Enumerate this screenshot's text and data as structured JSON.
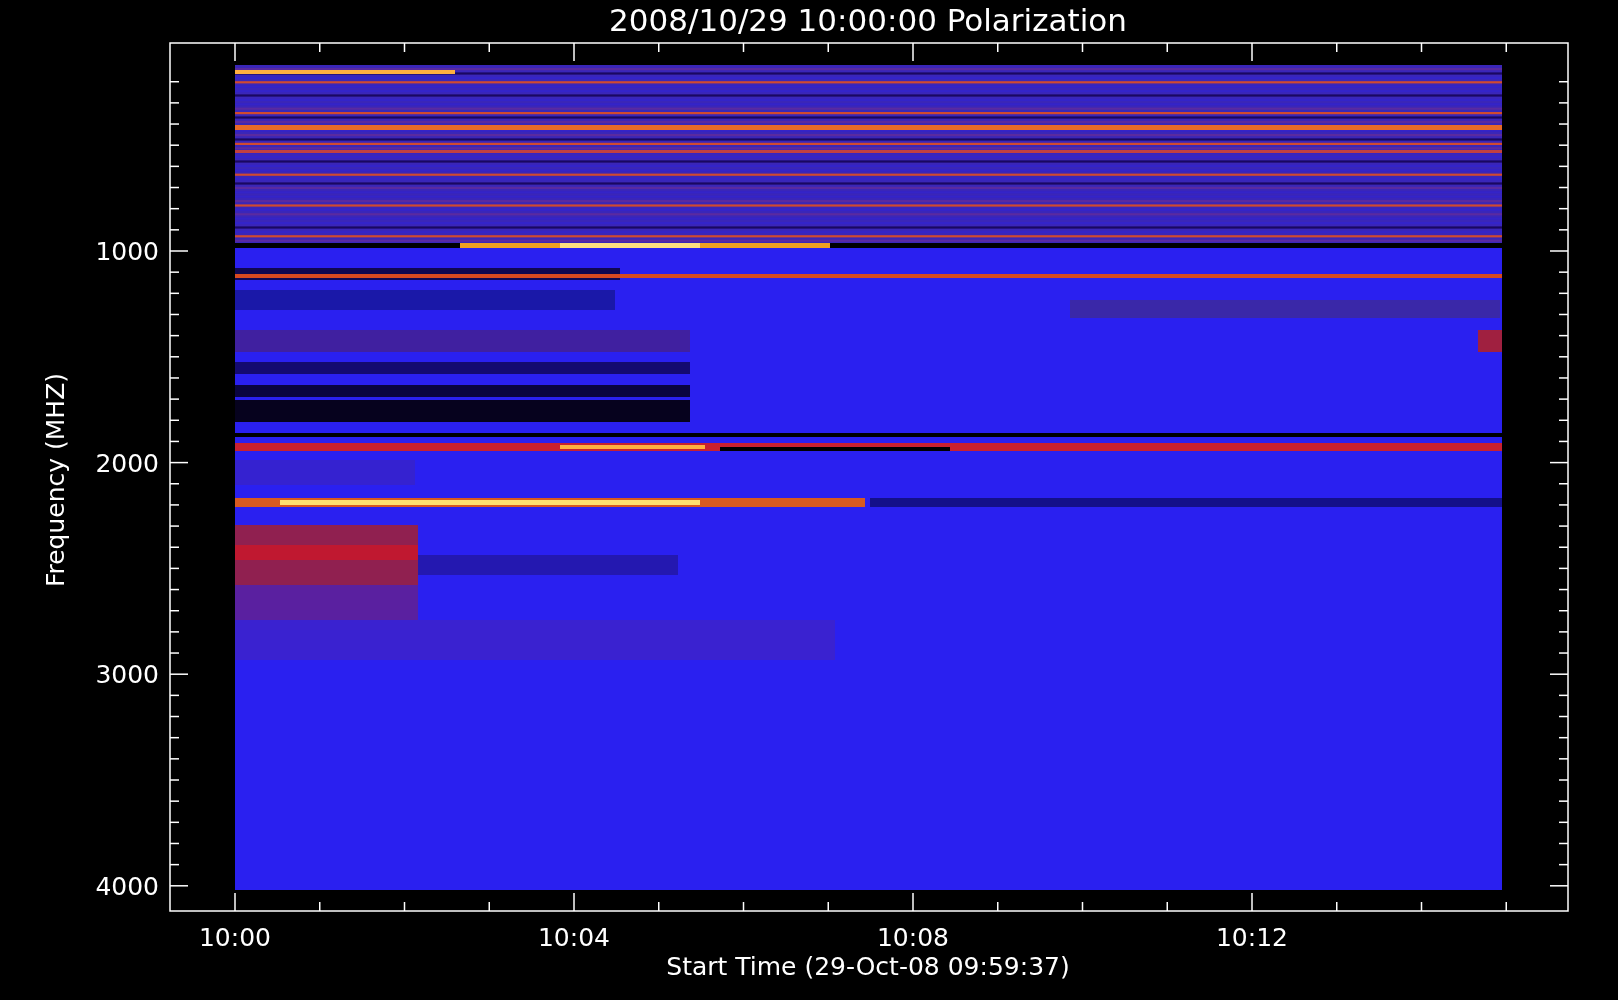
{
  "title": "2008/10/29 10:00:00 Polarization",
  "x_axis": {
    "label": "Start Time (29-Oct-08 09:59:37)",
    "ticks": [
      "10:00",
      "10:04",
      "10:08",
      "10:12"
    ]
  },
  "y_axis": {
    "label": "Frequency (MHZ)",
    "ticks": [
      "1000",
      "2000",
      "3000",
      "4000"
    ]
  }
}
